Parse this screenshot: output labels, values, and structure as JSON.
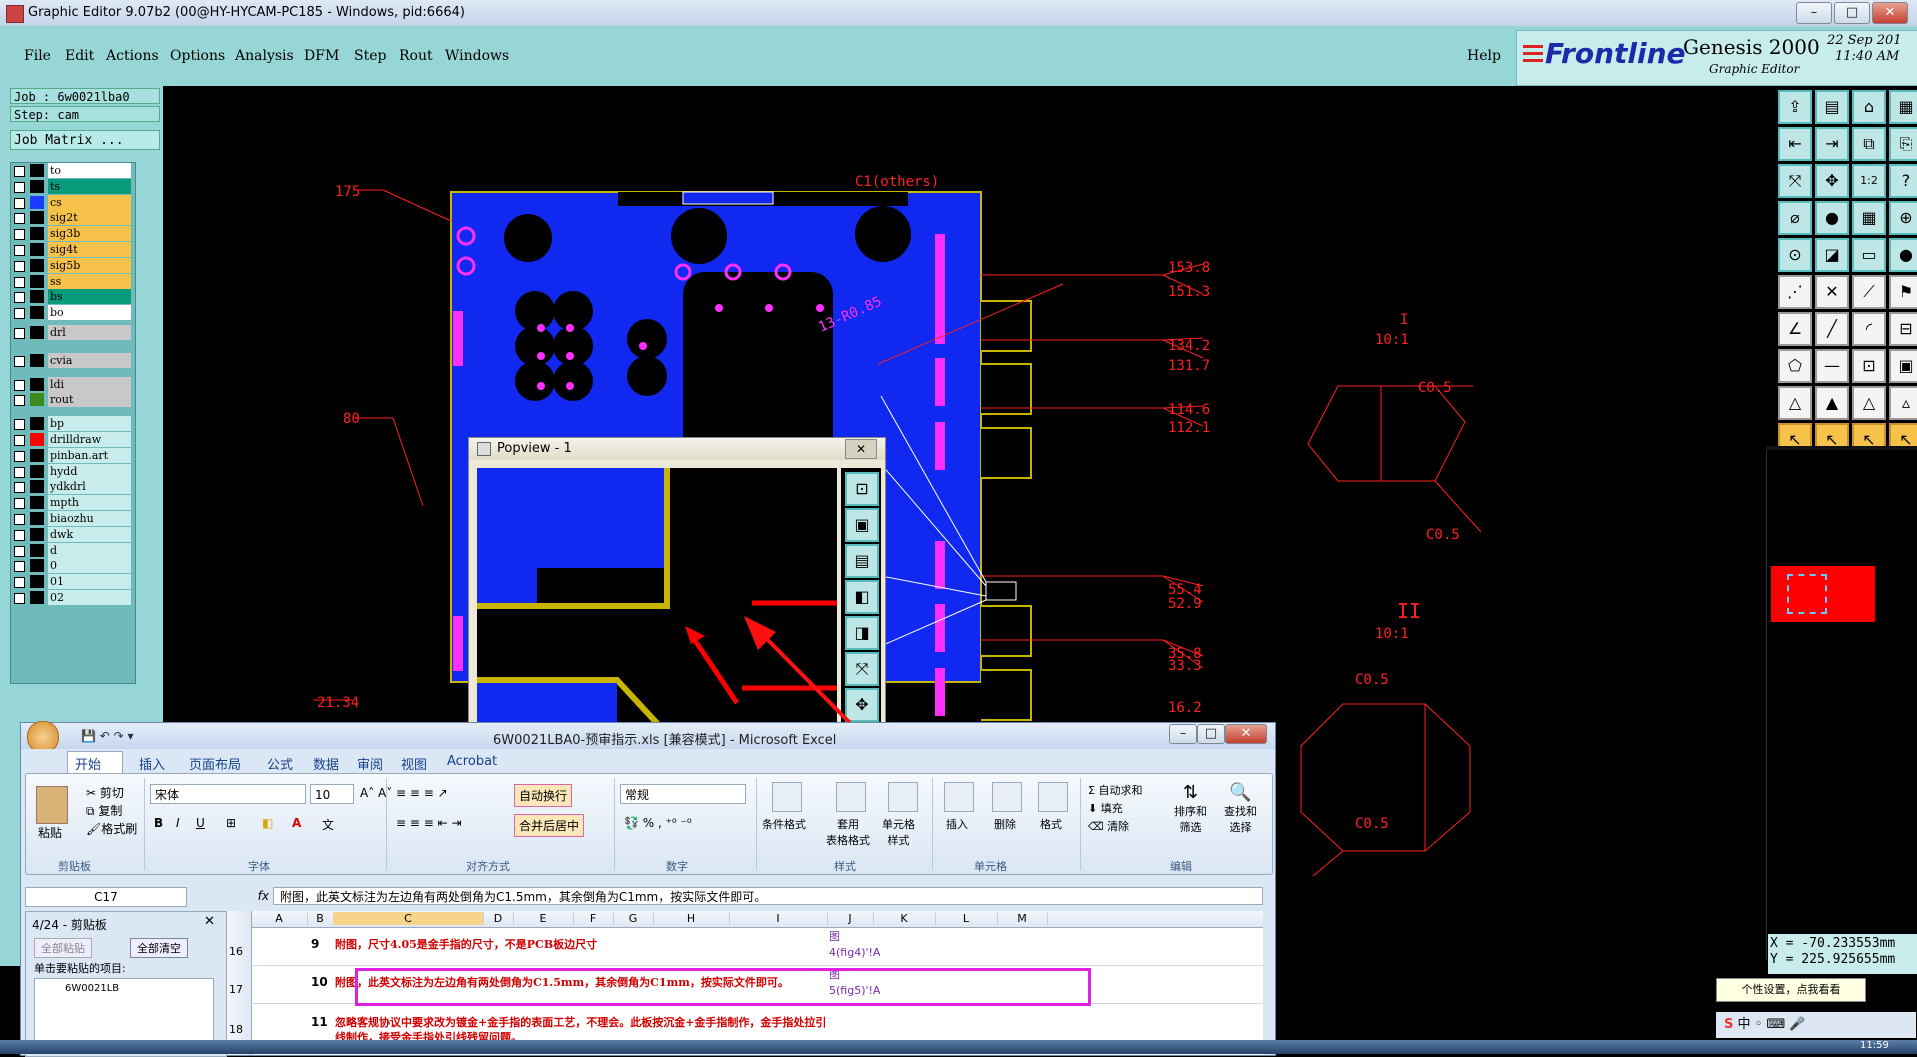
{
  "window": {
    "title": "Graphic Editor 9.07b2 (00@HY-HYCAM-PC185 - Windows, pid:6664)",
    "btn_min": "–",
    "btn_max": "□",
    "btn_close": "✕"
  },
  "menubar": {
    "items": [
      "File",
      "Edit",
      "Actions",
      "Options",
      "Analysis",
      "DFM",
      "Step",
      "Rout",
      "Windows"
    ],
    "help": "Help"
  },
  "branding": {
    "logo": "Frontline",
    "product": "Genesis 2000",
    "subtitle": "Graphic Editor",
    "date": "22 Sep 201",
    "time": "11:40 AM"
  },
  "job": {
    "job_label": "Job : 6w0021lba0",
    "step_label": "Step: cam",
    "matrix_button": "Job Matrix ..."
  },
  "layers": [
    {
      "name": "to",
      "bg": "#ffffff",
      "swatch": "#000000"
    },
    {
      "name": "ts",
      "bg": "#0a9b7c",
      "swatch": "#000000"
    },
    {
      "name": "cs",
      "bg": "#f6c24a",
      "swatch": "#1b3cff"
    },
    {
      "name": "sig2t",
      "bg": "#f6c24a",
      "swatch": "#000000"
    },
    {
      "name": "sig3b",
      "bg": "#f6c24a",
      "swatch": "#000000"
    },
    {
      "name": "sig4t",
      "bg": "#f6c24a",
      "swatch": "#000000"
    },
    {
      "name": "sig5b",
      "bg": "#f6c24a",
      "swatch": "#000000"
    },
    {
      "name": "ss",
      "bg": "#f6c24a",
      "swatch": "#000000"
    },
    {
      "name": "bs",
      "bg": "#0a9b7c",
      "swatch": "#000000"
    },
    {
      "name": "bo",
      "bg": "#ffffff",
      "swatch": "#000000"
    },
    {
      "name": "drl",
      "bg": "#c8c8c8",
      "swatch": "#000000"
    },
    {
      "name": "cvia",
      "bg": "#c8c8c8",
      "swatch": "#000000"
    },
    {
      "name": "ldi",
      "bg": "#c8c8c8",
      "swatch": "#000000"
    },
    {
      "name": "rout",
      "bg": "#c8c8c8",
      "swatch": "#3c8a1e"
    },
    {
      "name": "bp",
      "bg": "#c8ecec",
      "swatch": "#000000"
    },
    {
      "name": "drilldraw",
      "bg": "#c8ecec",
      "swatch": "#ff0000"
    },
    {
      "name": "pinban.art",
      "bg": "#c8ecec",
      "swatch": "#000000"
    },
    {
      "name": "hydd",
      "bg": "#c8ecec",
      "swatch": "#000000"
    },
    {
      "name": "ydkdrl",
      "bg": "#c8ecec",
      "swatch": "#000000"
    },
    {
      "name": "mpth",
      "bg": "#c8ecec",
      "swatch": "#000000"
    },
    {
      "name": "biaozhu",
      "bg": "#c8ecec",
      "swatch": "#000000"
    },
    {
      "name": "dwk",
      "bg": "#c8ecec",
      "swatch": "#000000"
    },
    {
      "name": "d",
      "bg": "#c8ecec",
      "swatch": "#000000"
    },
    {
      "name": "0",
      "bg": "#c8ecec",
      "swatch": "#000000"
    },
    {
      "name": "01",
      "bg": "#c8ecec",
      "swatch": "#000000"
    },
    {
      "name": "02",
      "bg": "#c8ecec",
      "swatch": "#000000"
    }
  ],
  "canvas": {
    "dims_left": [
      "175",
      "80",
      "21.34"
    ],
    "dims_right": [
      "153.8",
      "151.3",
      "134.2",
      "131.7",
      "114.6",
      "112.1",
      "55.4",
      "52.9",
      "35.8",
      "33.3",
      "16.2"
    ],
    "top_label": "C1(others)",
    "diag_label": "13-R0.85",
    "detail1": {
      "roman": "I",
      "scale": "10:1",
      "c1": "C0.5",
      "c2": "C0.5"
    },
    "detail2": {
      "roman": "II",
      "scale": "10:1",
      "c1": "C0.5",
      "c2": "C0.5"
    }
  },
  "coords": {
    "x": "X = -70.233553mm",
    "y": "Y = 225.925655mm",
    "unit": "MM"
  },
  "popview": {
    "title": "Popview - 1",
    "close": "✕"
  },
  "excel": {
    "title": "6W0021LBA0-预审指示.xls [兼容模式] - Microsoft Excel",
    "tabs": [
      "开始",
      "插入",
      "页面布局",
      "公式",
      "数据",
      "审阅",
      "视图",
      "Acrobat"
    ],
    "clipboard": {
      "paste": "粘贴",
      "cut": "剪切",
      "copy": "复制",
      "format": "格式刷",
      "group": "剪贴板"
    },
    "font": {
      "name": "宋体",
      "size": "10",
      "group": "字体"
    },
    "align": {
      "wrap": "自动换行",
      "merge": "合并后居中",
      "group": "对齐方式"
    },
    "number": {
      "format": "常规",
      "group": "数字"
    },
    "styles": {
      "cond": "条件格式",
      "table": "套用\n表格格式",
      "cell": "单元格\n样式",
      "group": "样式"
    },
    "cells": {
      "insert": "插入",
      "delete": "删除",
      "format": "格式",
      "group": "单元格"
    },
    "editing": {
      "autosum": "自动求和",
      "fill": "填充",
      "clear": "清除",
      "sort": "排序和\n筛选",
      "find": "查找和\n选择",
      "group": "编辑"
    },
    "namebox": "C17",
    "fx": "fx",
    "formula": "附图，此英文标注为左边角有两处倒角为C1.5mm，其余倒角为C1mm，按实际文件即可。",
    "clippane": {
      "title": "4/24 - 剪贴板",
      "paste_all": "全部粘贴",
      "clear_all": "全部清空",
      "hint": "单击要粘贴的项目:",
      "item": "6W0021LB"
    },
    "columns": [
      "A",
      "B",
      "C",
      "D",
      "E",
      "F",
      "G",
      "H",
      "I",
      "J",
      "K",
      "L",
      "M"
    ],
    "rows": [
      {
        "rownum": "16",
        "b": "9",
        "c": "附图，尺寸4.05是金手指的尺寸，不是PCB板边尺寸",
        "j": "图\n4(fig4)'!A"
      },
      {
        "rownum": "17",
        "b": "10",
        "c": "附图，此英文标注为左边角有两处倒角为C1.5mm，其余倒角为C1mm，按实际文件即可。",
        "j": "图\n5(fig5)'!A"
      },
      {
        "rownum": "18",
        "b": "11",
        "c": "忽略客规协议中要求改为镀金+金手指的表面工艺，不理会。此板按沉金+金手指制作，金手指处拉引线制作，接受金手指处引线残留问题。",
        "j": ""
      }
    ]
  },
  "tray": {
    "tooltip": "个性设置，点我看看",
    "ime": "中",
    "clock": "11:59"
  }
}
